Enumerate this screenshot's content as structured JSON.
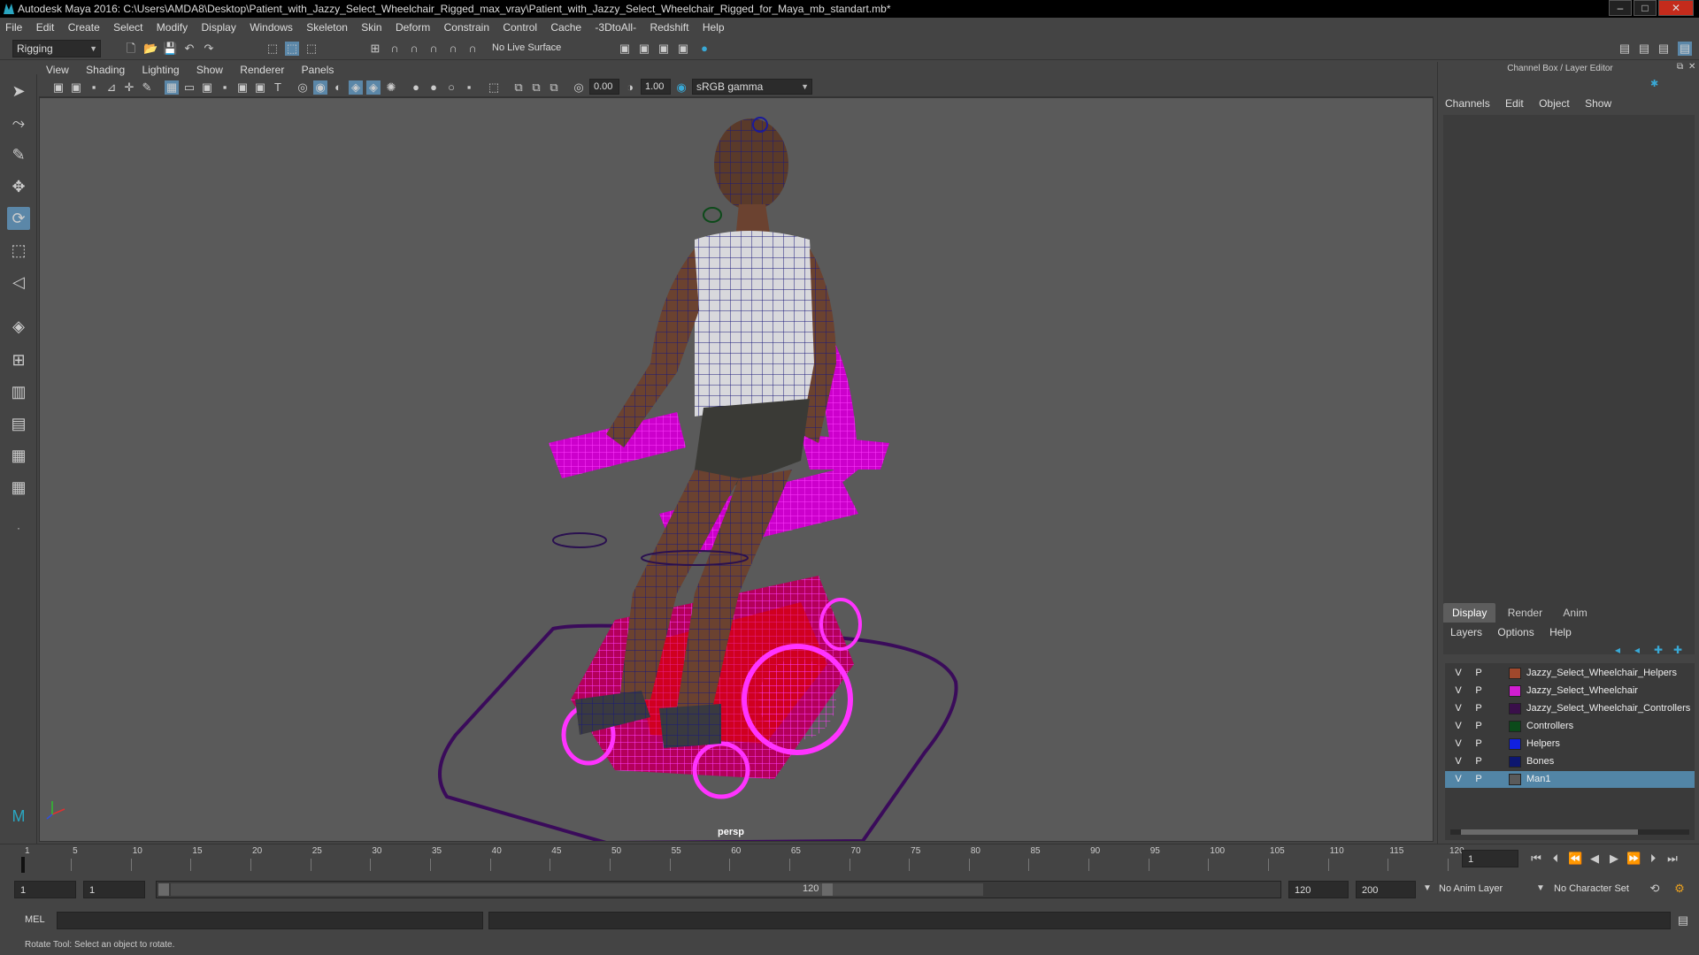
{
  "app": {
    "title": "Autodesk Maya 2016: C:\\Users\\AMDA8\\Desktop\\Patient_with_Jazzy_Select_Wheelchair_Rigged_max_vray\\Patient_with_Jazzy_Select_Wheelchair_Rigged_for_Maya_mb_standart.mb*"
  },
  "menubar": [
    "File",
    "Edit",
    "Create",
    "Select",
    "Modify",
    "Display",
    "Windows",
    "Skeleton",
    "Skin",
    "Deform",
    "Constrain",
    "Control",
    "Cache",
    "-3DtoAll-",
    "Redshift",
    "Help"
  ],
  "toolbar": {
    "mode": "Rigging",
    "live_surface": "No Live Surface"
  },
  "panel_menu": [
    "View",
    "Shading",
    "Lighting",
    "Show",
    "Renderer",
    "Panels"
  ],
  "viewport_toolbar": {
    "exposure": "0.00",
    "gamma": "1.00",
    "color_space": "sRGB gamma"
  },
  "viewport": {
    "camera": "persp"
  },
  "right_panel": {
    "title": "Channel Box / Layer Editor",
    "menu": [
      "Channels",
      "Edit",
      "Object",
      "Show"
    ],
    "tabs": [
      "Display",
      "Render",
      "Anim"
    ],
    "submenu": [
      "Layers",
      "Options",
      "Help"
    ],
    "layers": [
      {
        "v": "V",
        "p": "P",
        "name": "Jazzy_Select_Wheelchair_Helpers",
        "color": "#a0482c"
      },
      {
        "v": "V",
        "p": "P",
        "name": "Jazzy_Select_Wheelchair",
        "color": "#d21ed2"
      },
      {
        "v": "V",
        "p": "P",
        "name": "Jazzy_Select_Wheelchair_Controllers",
        "color": "#3a0f4a"
      },
      {
        "v": "V",
        "p": "P",
        "name": "Controllers",
        "color": "#0b4a1a"
      },
      {
        "v": "V",
        "p": "P",
        "name": "Helpers",
        "color": "#1020e0"
      },
      {
        "v": "V",
        "p": "P",
        "name": "Bones",
        "color": "#0c1670"
      },
      {
        "v": "V",
        "p": "P",
        "name": "Man1",
        "color": "#5a5a5a"
      }
    ]
  },
  "timeline": {
    "ticks": [
      "1",
      "5",
      "10",
      "15",
      "20",
      "25",
      "30",
      "35",
      "40",
      "45",
      "50",
      "55",
      "60",
      "65",
      "70",
      "75",
      "80",
      "85",
      "90",
      "95",
      "100",
      "105",
      "110",
      "115",
      "120"
    ],
    "current_frame": "1"
  },
  "range": {
    "start": "1",
    "playback_start": "1",
    "slider_start": "1",
    "slider_end": "120",
    "playback_end": "120",
    "end": "200",
    "anim_layer": "No Anim Layer",
    "character_set": "No Character Set"
  },
  "command_line": {
    "label": "MEL"
  },
  "status": {
    "text": "Rotate Tool: Select an object to rotate."
  }
}
